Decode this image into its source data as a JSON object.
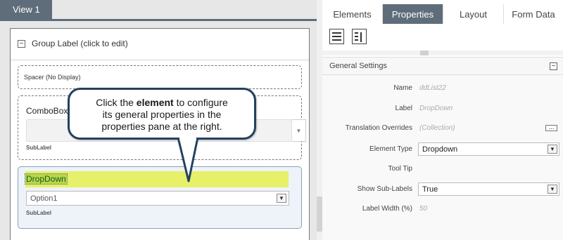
{
  "canvas": {
    "view_tab": "View 1",
    "group_label": "Group Label (click to edit)",
    "spacer_label": "Spacer (No Display)",
    "combobox": {
      "label": "ComboBox",
      "sublabel": "SubLabel"
    },
    "dropdown": {
      "label": "DropDown",
      "selected": "Option1",
      "sublabel": "SubLabel"
    }
  },
  "callout": {
    "prefix": "Click the ",
    "emphasis": "element",
    "line1_rest": "  to configure",
    "line2": "its general properties in the",
    "line3": "properties pane at the right."
  },
  "panel": {
    "tabs": [
      {
        "label": "Elements",
        "active": false
      },
      {
        "label": "Properties",
        "active": true
      },
      {
        "label": "Layout",
        "active": false
      },
      {
        "label": "Form Data",
        "active": false
      }
    ],
    "section_title": "General Settings",
    "properties": [
      {
        "name": "Name",
        "value": "ddList22"
      },
      {
        "name": "Label",
        "value": "DropDown"
      },
      {
        "name": "Translation Overrides",
        "value": "(Collection)"
      },
      {
        "name": "Element Type",
        "value": "Dropdown"
      },
      {
        "name": "Tool Tip",
        "value": ""
      },
      {
        "name": "Show Sub-Labels",
        "value": "True"
      },
      {
        "name": "Label Width (%)",
        "value": "50"
      }
    ]
  },
  "colors": {
    "accent_tab": "#5f6d7a",
    "callout_border": "#23415f",
    "highlight": "#e6f069",
    "selected_label_bg": "#b6d84a"
  }
}
